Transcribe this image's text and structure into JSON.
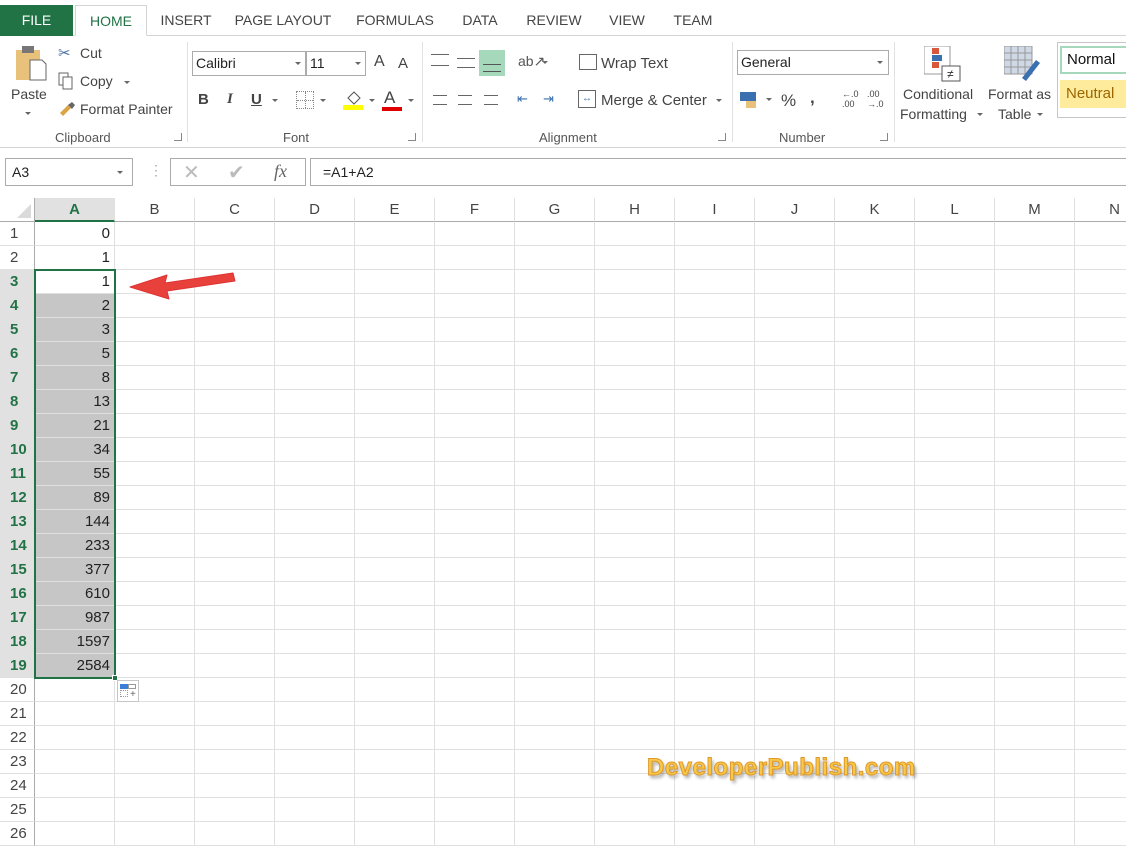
{
  "tabs": [
    "FILE",
    "HOME",
    "INSERT",
    "PAGE LAYOUT",
    "FORMULAS",
    "DATA",
    "REVIEW",
    "VIEW",
    "TEAM"
  ],
  "active_tab": "HOME",
  "clipboard": {
    "paste": "Paste",
    "cut": "Cut",
    "copy": "Copy",
    "format_painter": "Format Painter",
    "label": "Clipboard"
  },
  "font": {
    "name": "Calibri",
    "size": "11",
    "bold": "B",
    "italic": "I",
    "underline": "U",
    "label": "Font",
    "grow": "A",
    "shrink": "A",
    "font_color_letter": "A"
  },
  "alignment": {
    "wrap_text": "Wrap Text",
    "merge_center": "Merge & Center",
    "label": "Alignment"
  },
  "number": {
    "format": "General",
    "percent": "%",
    "comma": ",",
    "inc_decimal": "←.0 .00",
    "dec_decimal": ".00 →.0",
    "label": "Number"
  },
  "styles": {
    "conditional_1": "Conditional",
    "conditional_2": "Formatting",
    "format_table_1": "Format as",
    "format_table_2": "Table",
    "normal": "Normal",
    "neutral": "Neutral"
  },
  "formula_bar": {
    "name_box": "A3",
    "fx": "fx",
    "formula": "=A1+A2"
  },
  "columns": [
    "A",
    "B",
    "C",
    "D",
    "E",
    "F",
    "G",
    "H",
    "I",
    "J",
    "K",
    "L",
    "M",
    "N"
  ],
  "selected_column": "A",
  "rows": [
    {
      "n": "1",
      "a": "0"
    },
    {
      "n": "2",
      "a": "1"
    },
    {
      "n": "3",
      "a": "1"
    },
    {
      "n": "4",
      "a": "2"
    },
    {
      "n": "5",
      "a": "3"
    },
    {
      "n": "6",
      "a": "5"
    },
    {
      "n": "7",
      "a": "8"
    },
    {
      "n": "8",
      "a": "13"
    },
    {
      "n": "9",
      "a": "21"
    },
    {
      "n": "10",
      "a": "34"
    },
    {
      "n": "11",
      "a": "55"
    },
    {
      "n": "12",
      "a": "89"
    },
    {
      "n": "13",
      "a": "144"
    },
    {
      "n": "14",
      "a": "233"
    },
    {
      "n": "15",
      "a": "377"
    },
    {
      "n": "16",
      "a": "610"
    },
    {
      "n": "17",
      "a": "987"
    },
    {
      "n": "18",
      "a": "1597"
    },
    {
      "n": "19",
      "a": "2584"
    },
    {
      "n": "20",
      "a": ""
    },
    {
      "n": "21",
      "a": ""
    },
    {
      "n": "22",
      "a": ""
    },
    {
      "n": "23",
      "a": ""
    },
    {
      "n": "24",
      "a": ""
    },
    {
      "n": "25",
      "a": ""
    },
    {
      "n": "26",
      "a": ""
    }
  ],
  "selection": {
    "active_cell": "A3",
    "range_rows": [
      3,
      19
    ]
  },
  "watermark": "DeveloperPublish.com",
  "colors": {
    "accent": "#217346",
    "selection_fill": "#c6c6c6",
    "neutral_fill": "#ffeb9c",
    "arrow": "#e8403a"
  }
}
